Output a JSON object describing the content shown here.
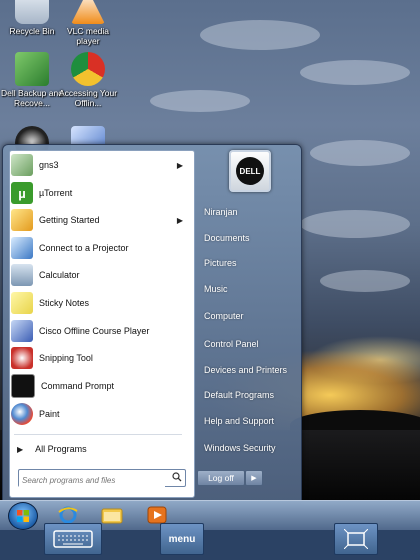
{
  "desktop": {
    "icons": [
      {
        "label": "Recycle Bin",
        "icon": "recycle-bin-icon"
      },
      {
        "label": "VLC media player",
        "icon": "vlc-icon"
      },
      {
        "label": "Dell Backup and Recove...",
        "icon": "dell-backup-icon"
      },
      {
        "label": "Accessing Your Offlin...",
        "icon": "chrome-icon"
      }
    ]
  },
  "start_menu": {
    "programs": [
      {
        "label": "gns3",
        "has_submenu": true
      },
      {
        "label": "µTorrent",
        "has_submenu": false
      },
      {
        "label": "Getting Started",
        "has_submenu": true
      },
      {
        "label": "Connect to a Projector",
        "has_submenu": false
      },
      {
        "label": "Calculator",
        "has_submenu": false
      },
      {
        "label": "Sticky Notes",
        "has_submenu": false
      },
      {
        "label": "Cisco Offline Course Player",
        "has_submenu": false
      },
      {
        "label": "Snipping Tool",
        "has_submenu": false
      },
      {
        "label": "Command Prompt",
        "has_submenu": false
      },
      {
        "label": "Paint",
        "has_submenu": false
      }
    ],
    "all_programs": "All Programs",
    "search_placeholder": "Search programs and files",
    "user_picture_text": "DELL",
    "right_items": [
      "Niranjan",
      "Documents",
      "Pictures",
      "Music",
      "Computer",
      "Control Panel",
      "Devices and Printers",
      "Default Programs",
      "Help and Support",
      "Windows Security"
    ],
    "logoff": "Log off",
    "arrow": "▶"
  },
  "controls": {
    "menu": "menu"
  },
  "colors": {
    "taskbar": "#5f7ea8",
    "accent": "#41658f"
  }
}
